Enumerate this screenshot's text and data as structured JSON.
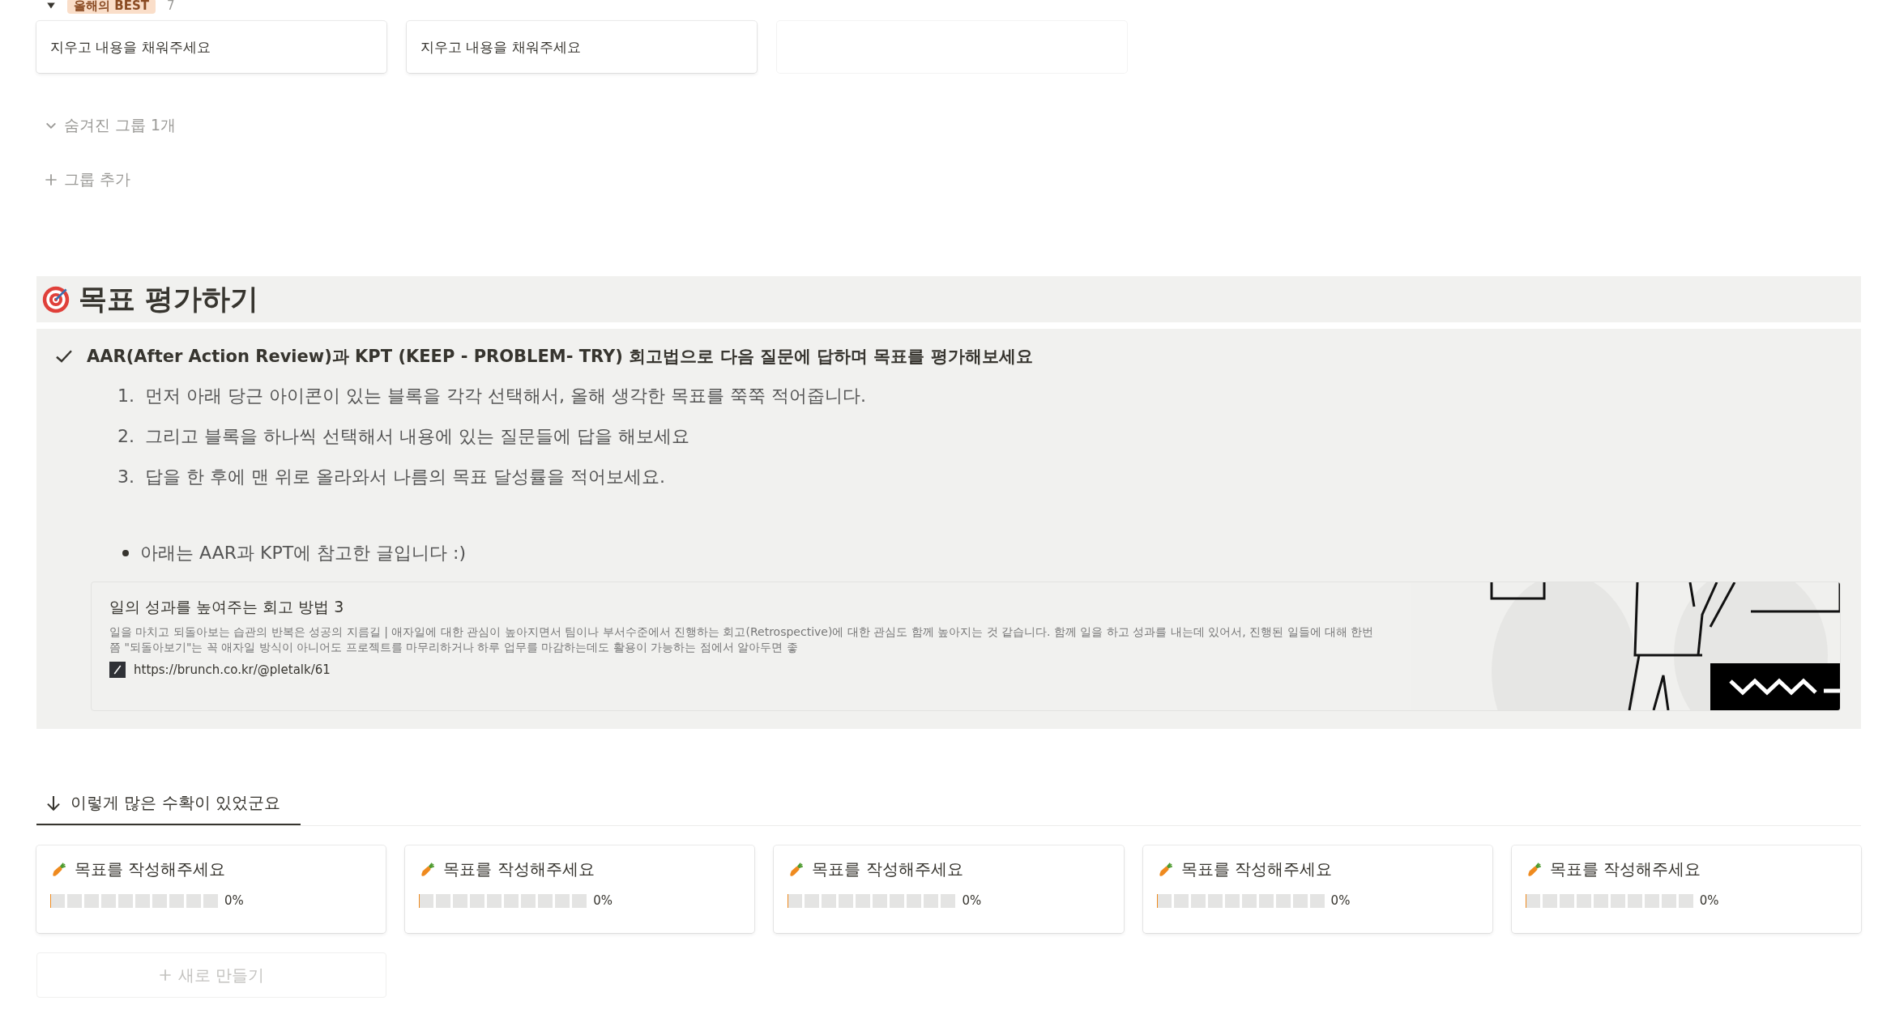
{
  "board_top": {
    "group": {
      "tag": "올해의 BEST",
      "count": "7",
      "expanded": true
    },
    "cards": [
      {
        "kind": "text",
        "text": "지우고 내용을 채워주세요"
      },
      {
        "kind": "text",
        "text": "지우고 내용을 채워주세요"
      },
      {
        "kind": "empty"
      }
    ],
    "hidden_groups": "숨겨진 그룹 1개",
    "add_group": "그룹 추가"
  },
  "section": {
    "heading": "목표 평가하기",
    "callout": {
      "title_prefix": "AAR(After Action Review)과 KPT (KEEP - PROBLEM- TRY) 회고법으로 다음 질문에 답하며 목표를 평가해보세요",
      "steps": [
        {
          "number": "1.",
          "text": "먼저 아래 당근 아이콘이 있는 블록을 각각 선택해서, 올해 생각한 목표를 쭉쭉 적어줍니다."
        },
        {
          "number": "2.",
          "text": "그리고 블록을 하나씩 선택해서 내용에 있는 질문들에 답을 해보세요"
        },
        {
          "number": "3.",
          "text": "답을 한 후에 맨 위로 올라와서 나름의 목표 달성률을 적어보세요."
        }
      ],
      "bullet": "아래는 AAR과 KPT에 참고한 글입니다 :)",
      "bookmark": {
        "title": "일의 성과를 높여주는 회고 방법 3",
        "description": "일을 마치고 되돌아보는 습관의 반복은 성공의 지름길 | 애자일에 대한 관심이 높아지면서 팀이나 부서수준에서 진행하는 회고(Retrospective)에 대한 관심도 함께 높아지는 것 같습니다. 함께 일을 하고 성과를 내는데 있어서, 진행된 일들에 대해 한번쯤 \"되돌아보기\"는 꼭 애자일 방식이 아니어도 프로젝트를 마무리하거나 하루 업무를 마감하는데도 활용이 가능하는 점에서 알아두면 좋",
        "url": "https://brunch.co.kr/@pletalk/61"
      }
    }
  },
  "gallery": {
    "tabs": [
      {
        "label": "이렇게 많은 수확이 있었군요",
        "selected": true
      }
    ],
    "cards": [
      {
        "title": "목표를 작성해주세요",
        "level": 0,
        "percent": "0%"
      },
      {
        "title": "목표를 작성해주세요",
        "level": 0,
        "percent": "0%"
      },
      {
        "title": "목표를 작성해주세요",
        "level": 0,
        "percent": "0%"
      },
      {
        "title": "목표를 작성해주세요",
        "level": 0,
        "percent": "0%"
      },
      {
        "title": "목표를 작성해주세요",
        "level": 0,
        "percent": "0%"
      }
    ],
    "new_button": "새로 만들기"
  }
}
